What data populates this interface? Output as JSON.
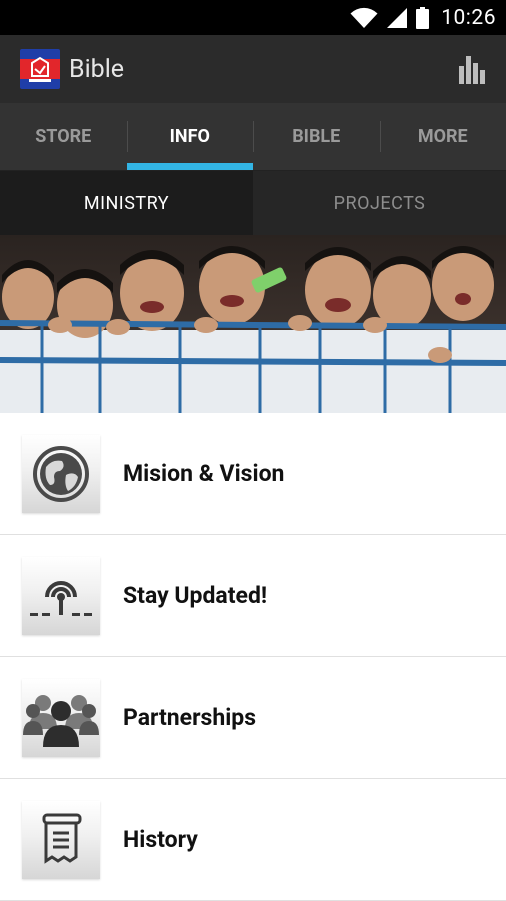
{
  "status_bar": {
    "time": "10:26"
  },
  "action_bar": {
    "title": "Bible",
    "logo_icon": "flag-bible-logo",
    "action_icon": "bar-chart-icon"
  },
  "tabs": [
    {
      "label": "STORE",
      "active": false
    },
    {
      "label": "INFO",
      "active": true
    },
    {
      "label": "BIBLE",
      "active": false
    },
    {
      "label": "MORE",
      "active": false
    }
  ],
  "subtabs": [
    {
      "label": "MINISTRY",
      "active": true
    },
    {
      "label": "PROJECTS",
      "active": false
    }
  ],
  "banner": {
    "description_icon": "children-photo"
  },
  "list": [
    {
      "label": "Mision & Vision",
      "icon": "globe-icon"
    },
    {
      "label": "Stay Updated!",
      "icon": "broadcast-icon"
    },
    {
      "label": "Partnerships",
      "icon": "group-icon"
    },
    {
      "label": "History",
      "icon": "scroll-icon"
    }
  ],
  "colors": {
    "accent": "#33b5e5",
    "actionbar": "#2b2b2b",
    "tabs": "#333333"
  }
}
